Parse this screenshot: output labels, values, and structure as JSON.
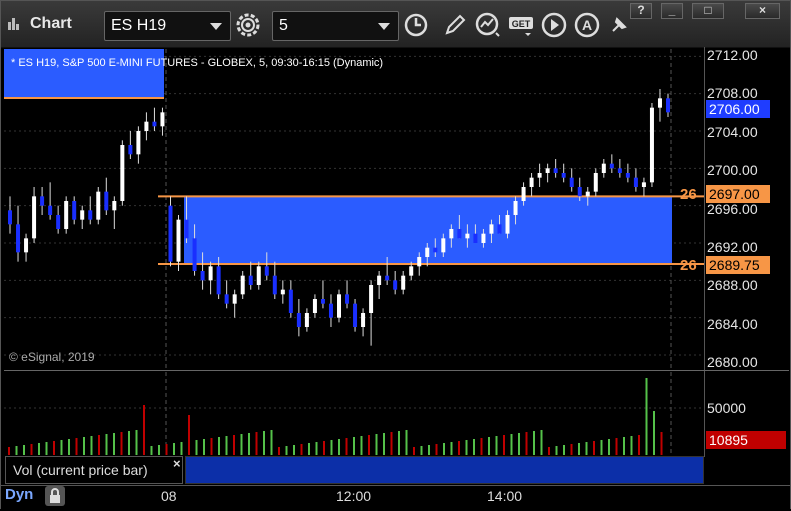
{
  "window": {
    "title": "Chart"
  },
  "toolbar": {
    "symbol": "ES H19",
    "interval": "5",
    "icons": [
      "gear-icon",
      "clock-icon",
      "pencil-icon",
      "indicator-icon",
      "get-icon",
      "play-icon",
      "alert-icon",
      "pin-icon"
    ]
  },
  "window_buttons": {
    "help": "?",
    "minimize": "_",
    "maximize": "□",
    "close": "×"
  },
  "chart": {
    "symbol_line": "* ES H19, S&P 500 E-MINI FUTURES - GLOBEX, 5, 09:30-16:15 (Dynamic)",
    "copyright": "© eSignal, 2019",
    "y_ticks": [
      "2712.00",
      "2708.00",
      "2704.00",
      "2700.00",
      "2696.00",
      "2692.00",
      "2688.00",
      "2684.00",
      "2680.00"
    ],
    "last_price": "2706.00",
    "upper_line_label": "2697.00",
    "lower_line_label": "2689.75",
    "upper_line_edge": "26",
    "lower_line_edge": "26",
    "colors": {
      "up": "#ffffff",
      "down": "#1a2fff",
      "zone": "#2b5cff",
      "zone_line": "#f79646",
      "last_price_bg": "#1f3dff"
    }
  },
  "volume": {
    "panel_label": "Vol (current price bar)",
    "close_glyph": "×",
    "y_tick": "50000",
    "current": "10895",
    "current_bg": "#c00000"
  },
  "xaxis": {
    "labels": [
      "08",
      "12:00",
      "14:00"
    ],
    "mode": "Dyn"
  },
  "chart_data": {
    "type": "candlestick",
    "title": "* ES H19, S&P 500 E-MINI FUTURES - GLOBEX, 5, 09:30-16:15 (Dynamic)",
    "xlabel": "",
    "ylabel": "",
    "ylim": [
      2680,
      2713
    ],
    "x_ticks": [
      "08",
      "12:00",
      "14:00"
    ],
    "horizontal_lines": [
      2697.0,
      2689.75
    ],
    "last": 2706.0,
    "volume_current": 10895
  }
}
